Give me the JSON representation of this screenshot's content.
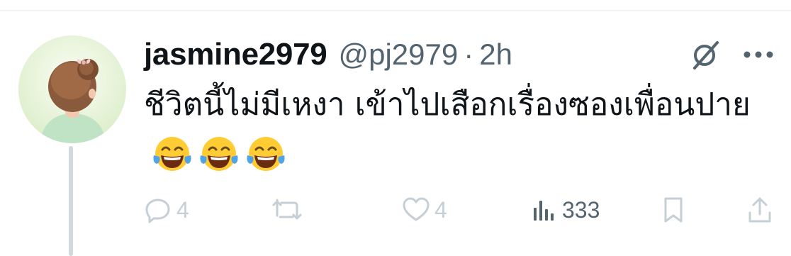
{
  "tweet": {
    "display_name": "jasmine2979",
    "handle": "@pj2979",
    "separator": "·",
    "time": "2h",
    "text": "ชีวิตนี้ไม่มีเหงา เข้าไปเสือกเรื่องซองเพื่อนปาย",
    "emoji": [
      "face-with-tears-of-joy-emoji",
      "face-with-tears-of-joy-emoji",
      "face-with-tears-of-joy-emoji"
    ],
    "avatar": "woman-with-bun-illustration"
  },
  "header_icons": [
    "grok-icon",
    "more-icon"
  ],
  "actions": {
    "reply": {
      "icon": "reply-icon",
      "count": "4"
    },
    "retweet": {
      "icon": "retweet-icon",
      "count": ""
    },
    "like": {
      "icon": "like-icon",
      "count": "4"
    },
    "views": {
      "icon": "views-icon",
      "count": "333"
    },
    "bookmark": {
      "icon": "bookmark-icon"
    },
    "share": {
      "icon": "share-icon"
    }
  },
  "colors": {
    "text": "#0f1419",
    "muted": "#536471",
    "icon_faint": "#c4cfd6",
    "thread_line": "#cfd9de",
    "emoji_yellow": "#ffcc33",
    "emoji_tear": "#4fa3e8"
  }
}
